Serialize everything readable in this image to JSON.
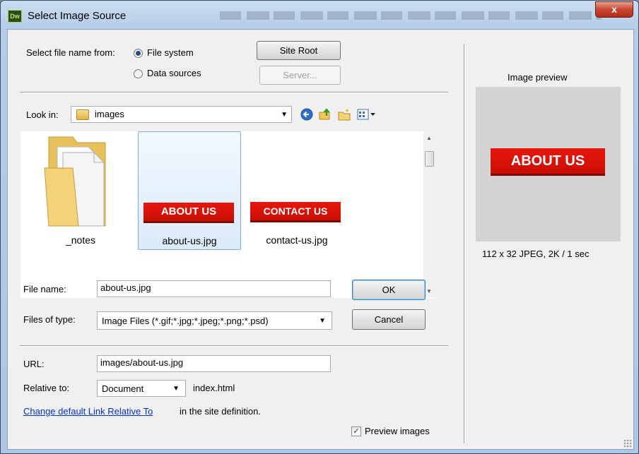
{
  "window": {
    "title": "Select Image Source",
    "app_icon_text": "Dw",
    "close_label": "x"
  },
  "source": {
    "label": "Select file name from:",
    "file_system": "File system",
    "data_sources": "Data sources",
    "site_root": "Site Root",
    "server": "Server...",
    "selected": "File system"
  },
  "look_in": {
    "label": "Look in:",
    "folder": "images"
  },
  "files": [
    {
      "name": "_notes",
      "type": "folder"
    },
    {
      "name": "about-us.jpg",
      "type": "image",
      "thumb_text": "ABOUT US",
      "selected": true
    },
    {
      "name": "contact-us.jpg",
      "type": "image",
      "thumb_text": "CONTACT US"
    }
  ],
  "form": {
    "file_name_label": "File name:",
    "file_name_value": "about-us.jpg",
    "files_of_type_label": "Files of type:",
    "files_of_type_value": "Image Files (*.gif;*.jpg;*.jpeg;*.png;*.psd)",
    "ok": "OK",
    "cancel": "Cancel"
  },
  "url": {
    "label": "URL:",
    "value": "images/about-us.jpg",
    "relative_label": "Relative to:",
    "relative_value": "Document",
    "relative_file": "index.html",
    "link_text": "Change default Link Relative To",
    "link_suffix": "in the site definition."
  },
  "preview": {
    "heading": "Image preview",
    "image_text": "ABOUT US",
    "info": "112 x 32 JPEG, 2K / 1 sec",
    "checkbox_label": "Preview images",
    "checked": true
  },
  "colors": {
    "thumb_red": "#e8160c",
    "link_blue": "#0033cc",
    "preview_bg": "#d3d3d3"
  }
}
